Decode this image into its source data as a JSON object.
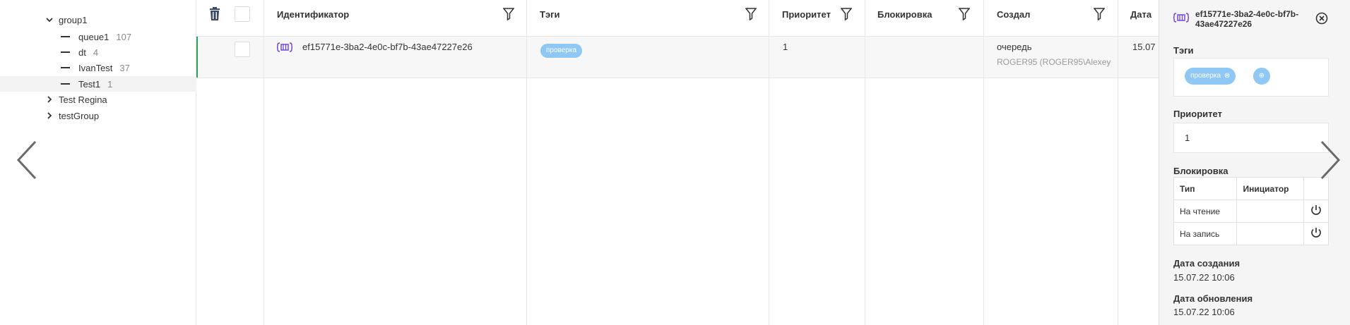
{
  "sidebar": {
    "items": [
      {
        "label": "group1",
        "count": "",
        "type": "expanded"
      },
      {
        "label": "queue1",
        "count": "107",
        "type": "leaf"
      },
      {
        "label": "dt",
        "count": "4",
        "type": "leaf"
      },
      {
        "label": "IvanTest",
        "count": "37",
        "type": "leaf"
      },
      {
        "label": "Test1",
        "count": "1",
        "type": "leaf-selected"
      },
      {
        "label": "Test Regina",
        "count": "",
        "type": "collapsed"
      },
      {
        "label": "testGroup",
        "count": "",
        "type": "collapsed"
      }
    ]
  },
  "table": {
    "columns": [
      "Идентификатор",
      "Тэги",
      "Приоритет",
      "Блокировка",
      "Создал",
      "Дата"
    ],
    "row": {
      "id": "ef15771e-3ba2-4e0c-bf7b-43ae47227e26",
      "tag": "проверка",
      "priority": "1",
      "lock": "",
      "created_by_line1": "очередь",
      "created_by_line2": "ROGER95 (ROGER95\\Alexey",
      "date": "15.07"
    }
  },
  "panel": {
    "title": "ef15771e-3ba2-4e0c-bf7b-43ae47227e26",
    "tags_label": "Тэги",
    "tag": "проверка",
    "priority_label": "Приоритет",
    "priority_value": "1",
    "lock_label": "Блокировка",
    "lock_headers": [
      "Тип",
      "Инициатор",
      ""
    ],
    "lock_rows": [
      {
        "type": "На чтение",
        "initiator": ""
      },
      {
        "type": "На запись",
        "initiator": ""
      }
    ],
    "created_label": "Дата создания",
    "created_value": "15.07.22 10:06",
    "updated_label": "Дата обновления",
    "updated_value": "15.07.22 10:06"
  },
  "colors": {
    "accent_green": "#2e9e5b",
    "tag_blue": "#8fc7f5",
    "queue_icon_purple": "#6a3ddb",
    "delete_icon": "#3a4a66"
  },
  "icons": [
    "trash-icon",
    "filter-icon",
    "queue-icon",
    "close-icon",
    "power-icon",
    "chevron-left-icon",
    "chevron-right-icon",
    "chevron-down-icon"
  ]
}
